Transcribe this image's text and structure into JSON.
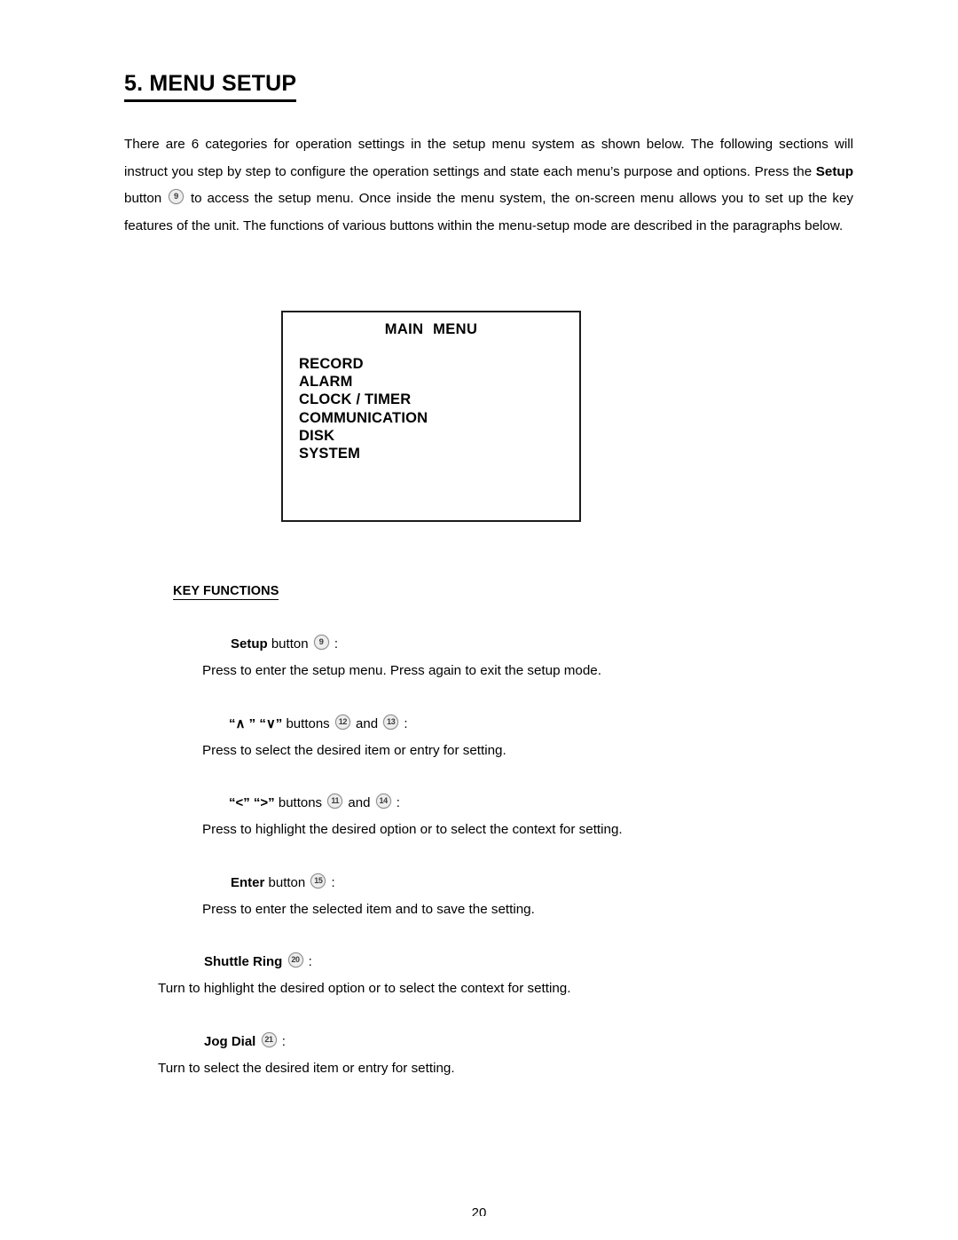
{
  "document": {
    "chapter_title": "5. MENU SETUP",
    "page_number": "20"
  },
  "intro": {
    "part1": "There are 6 categories for operation settings in the setup menu system as shown below. The following sections will instruct you step by step to configure the operation settings and state each menu’s purpose and options. Press the ",
    "bold1": "Setup",
    "part2": " button ",
    "badge1": "9",
    "part3": " to access the setup menu. Once inside the menu system, the on-screen menu allows you to set up the key features of the unit. The functions of various buttons within the menu-setup mode are described in the paragraphs below."
  },
  "osd_menu": {
    "title_word1": "MAIN",
    "title_word2": "MENU",
    "items": [
      {
        "label": "RECORD"
      },
      {
        "label": "ALARM"
      },
      {
        "label": "CLOCK / TIMER"
      },
      {
        "label": "COMMUNICATION"
      },
      {
        "label": "DISK"
      },
      {
        "label": "SYSTEM"
      }
    ]
  },
  "key_functions": {
    "heading": "KEY FUNCTIONS",
    "entries": [
      {
        "term_bold": "Setup",
        "term_rest": " button ",
        "badges": [
          "9"
        ],
        "term_between": "",
        "term_colon": " :",
        "description": "Press to enter the setup menu. Press again to exit the setup mode."
      },
      {
        "term_bold": "“∧ ” “∨”",
        "term_rest": " buttons ",
        "badges": [
          "12",
          "13"
        ],
        "term_between": " and ",
        "term_colon": " :",
        "description": "Press to select the desired item or entry for setting."
      },
      {
        "term_bold": "“<” “>”",
        "term_rest": " buttons ",
        "badges": [
          "11",
          "14"
        ],
        "term_between": " and ",
        "term_colon": " :",
        "description": "Press to highlight the desired option or to select the context for setting."
      },
      {
        "term_bold": "Enter",
        "term_rest": " button ",
        "badges": [
          "15"
        ],
        "term_between": "",
        "term_colon": " :",
        "description": "Press to enter the selected item and to save the setting."
      },
      {
        "term_bold": "Shuttle Ring",
        "term_rest": " ",
        "badges": [
          "20"
        ],
        "term_between": "",
        "term_colon": " :",
        "description": "Turn to highlight the desired option or to select the context for setting."
      },
      {
        "term_bold": "Jog Dial",
        "term_rest": " ",
        "badges": [
          "21"
        ],
        "term_between": "",
        "term_colon": " :",
        "description": "Turn to select the desired item or entry for setting."
      }
    ]
  }
}
